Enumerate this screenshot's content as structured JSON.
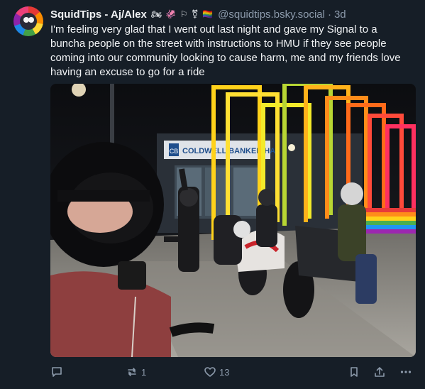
{
  "post": {
    "display_name": "SquidTips - Aj/Alex",
    "badges": "🏍 🦑 ⚐ ⚧ 🏳‍🌈",
    "handle": "@squidtips.bsky.social",
    "separator": "·",
    "time": "3d",
    "text": "I'm feeling very glad that I went out last night and gave my Signal to a buncha people on the street with instructions to HMU if they see people coming into our community looking to cause harm, me and my friends love having an excuse to go for a ride",
    "image": {
      "storefront_sign": "COLDWELL BANKER HAL",
      "storefront_logo": "CB"
    }
  },
  "actions": {
    "reply_count": "",
    "repost_count": "1",
    "like_count": "13"
  },
  "colors": {
    "background": "#161e27",
    "text": "#f1f3f5",
    "muted": "#8c9aab"
  }
}
